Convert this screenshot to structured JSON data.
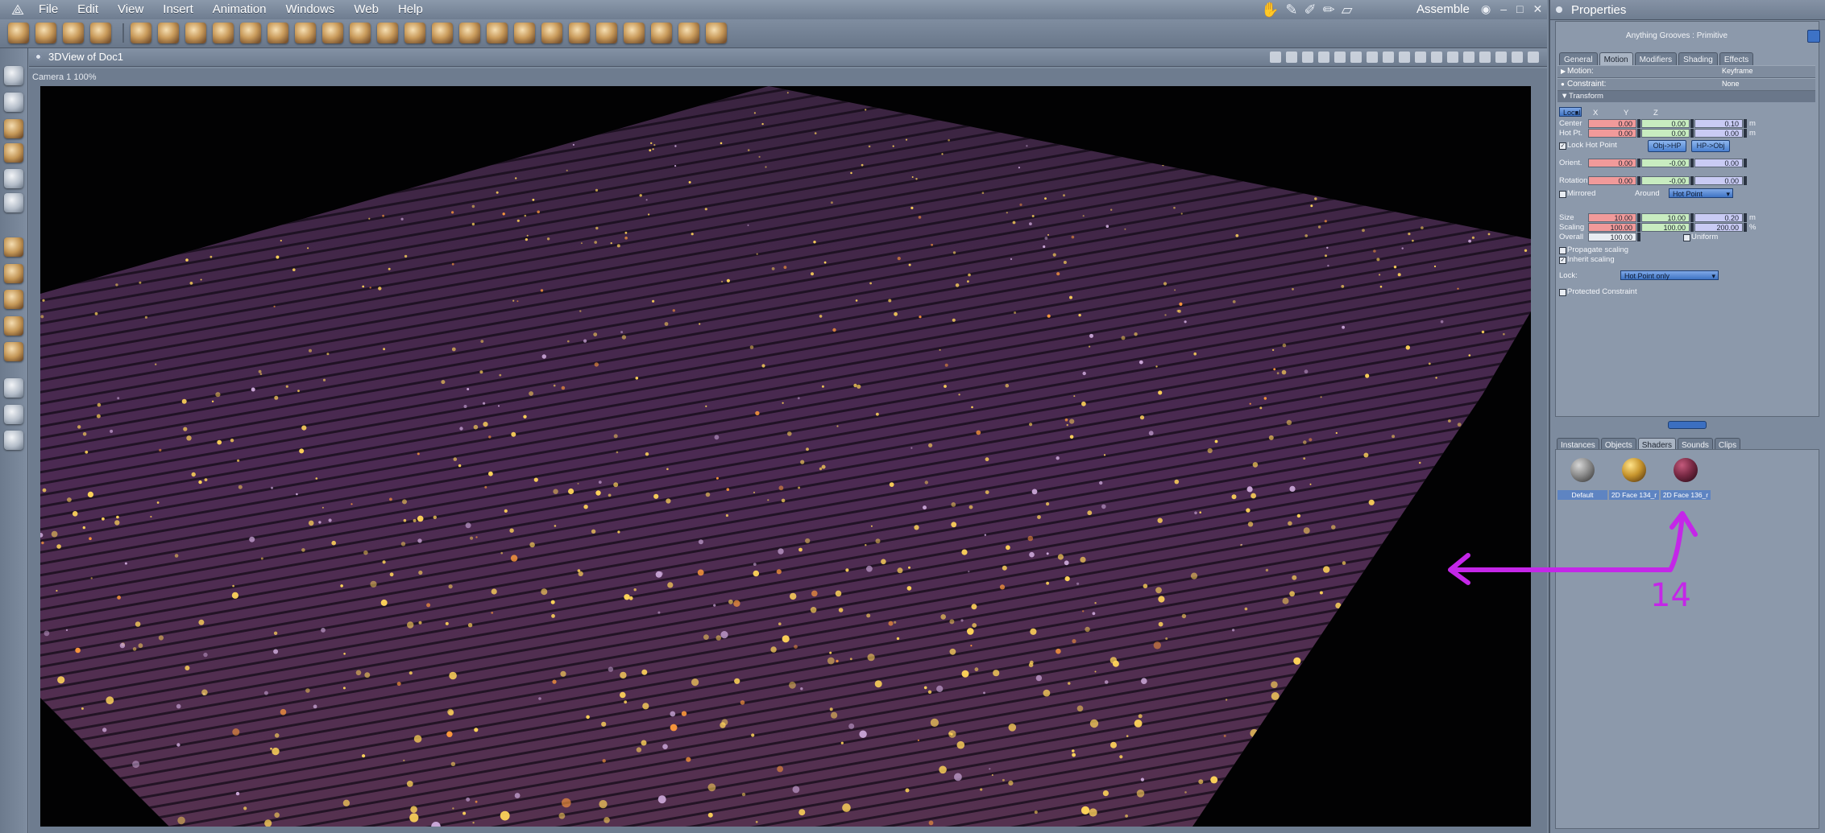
{
  "menubar": {
    "menus": [
      "File",
      "Edit",
      "View",
      "Insert",
      "Animation",
      "Windows",
      "Web",
      "Help"
    ],
    "room_name": "Assemble",
    "window_buttons": [
      "◉",
      "–",
      "□",
      "✕"
    ]
  },
  "view": {
    "title": "3DView of Doc1",
    "camera_label": "Camera 1 100%"
  },
  "properties": {
    "title": "Properties",
    "object_name": "Anything Grooves : Primitive",
    "tabs": [
      "General",
      "Motion",
      "Modifiers",
      "Shading",
      "Effects"
    ],
    "active_tab": "Motion",
    "motion_label": "Motion:",
    "motion_value": "Keyframe",
    "constraint_label": "Constraint:",
    "constraint_value": "None",
    "transform_label": "Transform",
    "space": "Local",
    "col_x": "X",
    "col_y": "Y",
    "col_z": "Z",
    "center_label": "Center",
    "center": [
      "0.00",
      "0.00",
      "0.10"
    ],
    "center_unit": "m",
    "hotpt_label": "Hot Pt.",
    "hotpt": [
      "0.00",
      "0.00",
      "0.00"
    ],
    "hotpt_unit": "m",
    "lock_hot_point": "Lock Hot Point",
    "obj_hp": "Obj->HP",
    "hp_obj": "HP->Obj",
    "orient_label": "Orient.",
    "orient": [
      "0.00",
      "-0.00",
      "0.00"
    ],
    "rotation_label": "Rotation",
    "rotation": [
      "0.00",
      "-0.00",
      "0.00"
    ],
    "mirrored": "Mirrored",
    "around": "Around",
    "around_value": "Hot Point",
    "size_label": "Size",
    "size": [
      "10.00",
      "10.00",
      "0.20"
    ],
    "size_unit": "m",
    "scaling_label": "Scaling",
    "scaling": [
      "100.00",
      "100.00",
      "200.00"
    ],
    "scaling_unit": "%",
    "overall_label": "Overall",
    "overall": "100.00",
    "uniform": "Uniform",
    "propagate_scaling": "Propagate scaling",
    "inherit_scaling": "Inherit scaling",
    "lock_label": "Lock:",
    "lock_value": "Hot Point only",
    "protected_constraint": "Protected Constraint"
  },
  "library": {
    "tabs": [
      "Instances",
      "Objects",
      "Shaders",
      "Sounds",
      "Clips"
    ],
    "active_tab": "Shaders",
    "shaders": [
      {
        "name": "Default",
        "color": "#8d8d8d"
      },
      {
        "name": "2D Face 134_r",
        "color": "#c8962e"
      },
      {
        "name": "2D Face 136_r",
        "color": "#7a2a45"
      }
    ]
  },
  "annotation": {
    "number": "14",
    "color": "#c426e8"
  },
  "colors": {
    "ui_base": "#7c8a9c",
    "accent": "#3d72c6",
    "terrain": "#4a2a4f",
    "sparkle": "#ffd45a"
  }
}
